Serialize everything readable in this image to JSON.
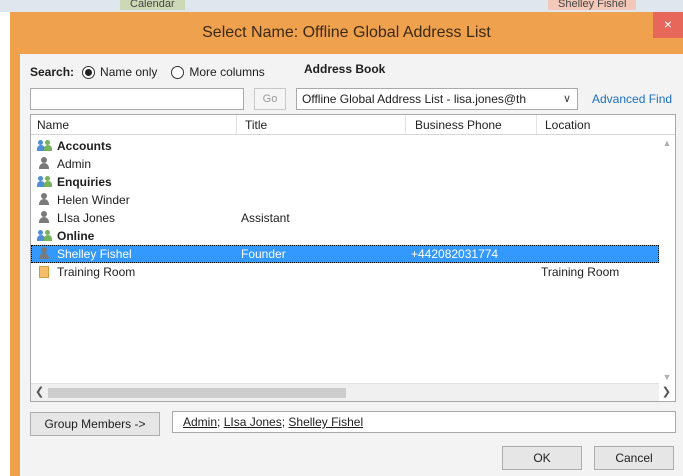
{
  "background": {
    "tab_left": "Calendar",
    "tab_right": "Shelley Fishel"
  },
  "dialog": {
    "title": "Select Name: Offline Global Address List",
    "close_glyph": "×"
  },
  "search": {
    "label": "Search:",
    "options": [
      "Name only",
      "More columns"
    ],
    "selected": "Name only",
    "query_value": "",
    "go_label": "Go"
  },
  "address_book": {
    "label": "Address Book",
    "selected": "Offline Global Address List - lisa.jones@th",
    "advanced_find": "Advanced Find"
  },
  "list": {
    "columns": [
      "Name",
      "Title",
      "Business Phone",
      "Location"
    ],
    "rows": [
      {
        "type": "group",
        "name": "Accounts",
        "title": "",
        "phone": "",
        "location": ""
      },
      {
        "type": "person",
        "name": "Admin",
        "title": "",
        "phone": "",
        "location": ""
      },
      {
        "type": "group",
        "name": "Enquiries",
        "title": "",
        "phone": "",
        "location": ""
      },
      {
        "type": "person",
        "name": "Helen Winder",
        "title": "",
        "phone": "",
        "location": ""
      },
      {
        "type": "person",
        "name": "LIsa Jones",
        "title": "Assistant",
        "phone": "",
        "location": ""
      },
      {
        "type": "group",
        "name": "Online",
        "title": "",
        "phone": "",
        "location": ""
      },
      {
        "type": "person",
        "name": "Shelley Fishel",
        "title": "Founder",
        "phone": "+442082031774",
        "location": "",
        "selected": true
      },
      {
        "type": "room",
        "name": "Training Room",
        "title": "",
        "phone": "",
        "location": "Training Room"
      }
    ]
  },
  "footer": {
    "group_members_label": "Group Members ->",
    "recipients": [
      "Admin",
      "LIsa Jones",
      "Shelley Fishel"
    ],
    "ok_label": "OK",
    "cancel_label": "Cancel"
  },
  "colors": {
    "title_bar": "#f0a14d",
    "selection": "#3399ff",
    "link": "#1b6fbf",
    "close_button": "#e8675b"
  }
}
